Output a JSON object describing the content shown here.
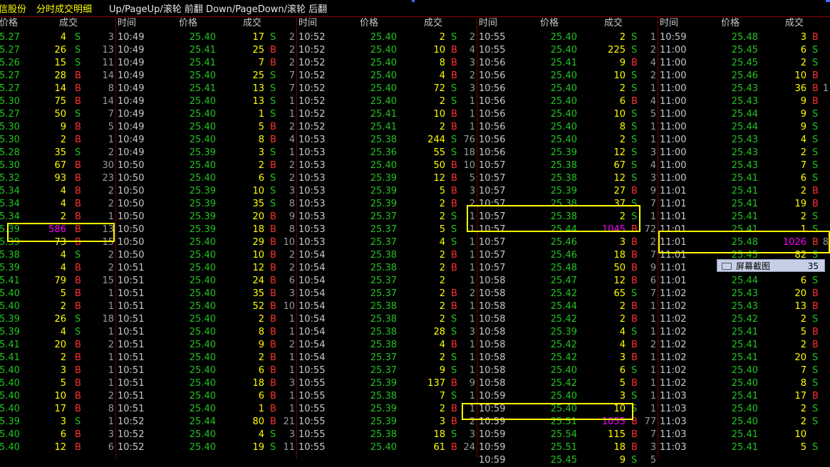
{
  "header": {
    "stock_name": "信股份",
    "view_title": "分时成交明细",
    "nav_hint": "Up/PageUp/滚轮 前翻 Down/PageDown/滚轮 后翻"
  },
  "column_headers": {
    "time": "时间",
    "price": "价格",
    "volume": "成交"
  },
  "columns": [
    {
      "rows": [
        [
          "",
          "5.27",
          "4",
          "S",
          "3"
        ],
        [
          "",
          "5.27",
          "26",
          "S",
          "13"
        ],
        [
          "",
          "5.26",
          "15",
          "S",
          "11"
        ],
        [
          "",
          "5.27",
          "28",
          "B",
          "14"
        ],
        [
          "",
          "5.27",
          "14",
          "B",
          "8"
        ],
        [
          "",
          "5.30",
          "75",
          "B",
          "14"
        ],
        [
          "",
          "5.27",
          "50",
          "S",
          "7"
        ],
        [
          "",
          "5.30",
          "9",
          "B",
          "5"
        ],
        [
          "",
          "5.30",
          "2",
          "B",
          "1"
        ],
        [
          "",
          "5.28",
          "35",
          "S",
          "2"
        ],
        [
          "",
          "5.30",
          "67",
          "B",
          "30"
        ],
        [
          "",
          "5.32",
          "93",
          "B",
          "23"
        ],
        [
          "",
          "5.34",
          "4",
          "B",
          "2"
        ],
        [
          "",
          "5.34",
          "4",
          "B",
          "2"
        ],
        [
          "",
          "5.34",
          "2",
          "B",
          "1"
        ],
        [
          "",
          "5.39",
          "586",
          "B",
          "13"
        ],
        [
          "",
          "5.39",
          "73",
          "B",
          "15"
        ],
        [
          "",
          "5.38",
          "4",
          "S",
          "2"
        ],
        [
          "",
          "5.39",
          "4",
          "B",
          "2"
        ],
        [
          "",
          "5.41",
          "79",
          "B",
          "15"
        ],
        [
          "",
          "5.40",
          "5",
          "B",
          "1"
        ],
        [
          "",
          "5.40",
          "2",
          "B",
          "1"
        ],
        [
          "",
          "5.39",
          "26",
          "S",
          "18"
        ],
        [
          "",
          "5.39",
          "4",
          "S",
          "1"
        ],
        [
          "",
          "5.41",
          "20",
          "B",
          "2"
        ],
        [
          "",
          "5.41",
          "2",
          "B",
          "1"
        ],
        [
          "",
          "5.40",
          "3",
          "B",
          "1"
        ],
        [
          "",
          "5.40",
          "5",
          "B",
          "1"
        ],
        [
          "",
          "5.40",
          "10",
          "B",
          "2"
        ],
        [
          "",
          "5.40",
          "17",
          "B",
          "8"
        ],
        [
          "",
          "5.39",
          "3",
          "S",
          "1"
        ],
        [
          "",
          "5.40",
          "6",
          "B",
          "3"
        ],
        [
          "",
          "5.40",
          "12",
          "B",
          "6"
        ]
      ]
    },
    {
      "rows": [
        [
          "10:49",
          "25.40",
          "17",
          "S",
          "2"
        ],
        [
          "10:49",
          "25.41",
          "25",
          "B",
          "2"
        ],
        [
          "10:49",
          "25.41",
          "7",
          "B",
          "2"
        ],
        [
          "10:49",
          "25.40",
          "25",
          "S",
          "7"
        ],
        [
          "10:49",
          "25.41",
          "13",
          "S",
          "7"
        ],
        [
          "10:49",
          "25.40",
          "13",
          "S",
          "1"
        ],
        [
          "10:49",
          "25.40",
          "1",
          "S",
          "1"
        ],
        [
          "10:49",
          "25.40",
          "5",
          "B",
          "2"
        ],
        [
          "10:49",
          "25.40",
          "8",
          "B",
          "4"
        ],
        [
          "10:49",
          "25.39",
          "3",
          "S",
          "1"
        ],
        [
          "10:50",
          "25.40",
          "2",
          "B",
          "2"
        ],
        [
          "10:50",
          "25.40",
          "6",
          "S",
          "2"
        ],
        [
          "10:50",
          "25.39",
          "10",
          "S",
          "3"
        ],
        [
          "10:50",
          "25.39",
          "35",
          "S",
          "8"
        ],
        [
          "10:50",
          "25.39",
          "20",
          "B",
          "9"
        ],
        [
          "10:50",
          "25.39",
          "18",
          "B",
          "8"
        ],
        [
          "10:50",
          "25.40",
          "29",
          "B",
          "10"
        ],
        [
          "10:50",
          "25.40",
          "10",
          "B",
          "2"
        ],
        [
          "10:51",
          "25.40",
          "12",
          "B",
          "2"
        ],
        [
          "10:51",
          "25.40",
          "24",
          "B",
          "6"
        ],
        [
          "10:51",
          "25.40",
          "35",
          "B",
          "3"
        ],
        [
          "10:51",
          "25.40",
          "52",
          "B",
          "10"
        ],
        [
          "10:51",
          "25.40",
          "2",
          "B",
          "1"
        ],
        [
          "10:51",
          "25.40",
          "8",
          "B",
          "1"
        ],
        [
          "10:51",
          "25.40",
          "9",
          "B",
          "2"
        ],
        [
          "10:51",
          "25.40",
          "2",
          "B",
          "1"
        ],
        [
          "10:51",
          "25.40",
          "6",
          "B",
          "1"
        ],
        [
          "10:51",
          "25.40",
          "18",
          "B",
          "3"
        ],
        [
          "10:51",
          "25.40",
          "6",
          "B",
          "1"
        ],
        [
          "10:51",
          "25.40",
          "1",
          "B",
          "1"
        ],
        [
          "10:52",
          "25.44",
          "80",
          "B",
          "21"
        ],
        [
          "10:52",
          "25.40",
          "4",
          "S",
          "3"
        ],
        [
          "10:52",
          "25.40",
          "19",
          "S",
          "11"
        ]
      ]
    },
    {
      "rows": [
        [
          "10:52",
          "25.40",
          "2",
          "S",
          "2"
        ],
        [
          "10:52",
          "25.40",
          "10",
          "B",
          "4"
        ],
        [
          "10:52",
          "25.40",
          "8",
          "B",
          "3"
        ],
        [
          "10:52",
          "25.40",
          "4",
          "B",
          "2"
        ],
        [
          "10:52",
          "25.40",
          "72",
          "S",
          "3"
        ],
        [
          "10:52",
          "25.40",
          "2",
          "S",
          "1"
        ],
        [
          "10:52",
          "25.41",
          "10",
          "B",
          "1"
        ],
        [
          "10:52",
          "25.41",
          "2",
          "B",
          "1"
        ],
        [
          "10:53",
          "25.38",
          "244",
          "S",
          "76"
        ],
        [
          "10:53",
          "25.36",
          "55",
          "S",
          "18"
        ],
        [
          "10:53",
          "25.40",
          "50",
          "B",
          "10"
        ],
        [
          "10:53",
          "25.39",
          "12",
          "B",
          "5"
        ],
        [
          "10:53",
          "25.39",
          "5",
          "B",
          "3"
        ],
        [
          "10:53",
          "25.39",
          "2",
          "B",
          "2"
        ],
        [
          "10:53",
          "25.37",
          "2",
          "S",
          "1"
        ],
        [
          "10:53",
          "25.37",
          "5",
          "S",
          "1"
        ],
        [
          "10:53",
          "25.37",
          "4",
          "S",
          "1"
        ],
        [
          "10:54",
          "25.38",
          "2",
          "B",
          "1"
        ],
        [
          "10:54",
          "25.38",
          "2",
          "B",
          "1"
        ],
        [
          "10:54",
          "25.37",
          "2",
          "",
          "1"
        ],
        [
          "10:54",
          "25.37",
          "2",
          "B",
          "2"
        ],
        [
          "10:54",
          "25.38",
          "2",
          "B",
          "1"
        ],
        [
          "10:54",
          "25.38",
          "2",
          "S",
          "1"
        ],
        [
          "10:54",
          "25.38",
          "28",
          "S",
          "3"
        ],
        [
          "10:54",
          "25.38",
          "4",
          "B",
          "1"
        ],
        [
          "10:54",
          "25.37",
          "2",
          "S",
          "1"
        ],
        [
          "10:55",
          "25.37",
          "9",
          "S",
          "1"
        ],
        [
          "10:55",
          "25.39",
          "137",
          "B",
          "9"
        ],
        [
          "10:55",
          "25.38",
          "7",
          "S",
          "1"
        ],
        [
          "10:55",
          "25.39",
          "2",
          "B",
          "1"
        ],
        [
          "10:55",
          "25.39",
          "3",
          "B",
          "2"
        ],
        [
          "10:55",
          "25.38",
          "18",
          "S",
          "3"
        ],
        [
          "10:55",
          "25.40",
          "61",
          "B",
          "24"
        ]
      ]
    },
    {
      "rows": [
        [
          "10:55",
          "25.40",
          "2",
          "S",
          "1"
        ],
        [
          "10:55",
          "25.40",
          "225",
          "S",
          "2"
        ],
        [
          "10:56",
          "25.41",
          "9",
          "B",
          "4"
        ],
        [
          "10:56",
          "25.40",
          "10",
          "S",
          "2"
        ],
        [
          "10:56",
          "25.40",
          "2",
          "S",
          "1"
        ],
        [
          "10:56",
          "25.40",
          "6",
          "B",
          "4"
        ],
        [
          "10:56",
          "25.40",
          "10",
          "S",
          "5"
        ],
        [
          "10:56",
          "25.40",
          "8",
          "S",
          "1"
        ],
        [
          "10:56",
          "25.40",
          "2",
          "S",
          "1"
        ],
        [
          "10:56",
          "25.39",
          "12",
          "S",
          "3"
        ],
        [
          "10:57",
          "25.38",
          "67",
          "S",
          "4"
        ],
        [
          "10:57",
          "25.38",
          "12",
          "S",
          "3"
        ],
        [
          "10:57",
          "25.39",
          "27",
          "B",
          "9"
        ],
        [
          "10:57",
          "25.38",
          "37",
          "S",
          "7"
        ],
        [
          "10:57",
          "25.38",
          "2",
          "S",
          "1"
        ],
        [
          "10:57",
          "25.44",
          "1045",
          "B",
          "72"
        ],
        [
          "10:57",
          "25.46",
          "3",
          "B",
          "2"
        ],
        [
          "10:57",
          "25.46",
          "18",
          "B",
          "7"
        ],
        [
          "10:57",
          "25.48",
          "50",
          "B",
          "9"
        ],
        [
          "10:58",
          "25.47",
          "12",
          "B",
          "6"
        ],
        [
          "10:58",
          "25.42",
          "65",
          "S",
          "7"
        ],
        [
          "10:58",
          "25.44",
          "2",
          "B",
          "1"
        ],
        [
          "10:58",
          "25.42",
          "2",
          "B",
          "1"
        ],
        [
          "10:58",
          "25.39",
          "4",
          "S",
          "1"
        ],
        [
          "10:58",
          "25.42",
          "4",
          "B",
          "2"
        ],
        [
          "10:58",
          "25.42",
          "3",
          "B",
          "1"
        ],
        [
          "10:58",
          "25.40",
          "6",
          "S",
          "1"
        ],
        [
          "10:58",
          "25.42",
          "5",
          "B",
          "1"
        ],
        [
          "10:59",
          "25.40",
          "3",
          "S",
          "1"
        ],
        [
          "10:59",
          "25.40",
          "10",
          "S",
          "1"
        ],
        [
          "10:59",
          "25.51",
          "1055",
          "B",
          "77"
        ],
        [
          "10:59",
          "25.54",
          "115",
          "B",
          "7"
        ],
        [
          "10:59",
          "25.51",
          "18",
          "B",
          "3"
        ],
        [
          "10:59",
          "25.45",
          "9",
          "S",
          "5"
        ]
      ]
    },
    {
      "rows": [
        [
          "10:59",
          "25.48",
          "3",
          "B",
          ""
        ],
        [
          "11:00",
          "25.45",
          "6",
          "S",
          ""
        ],
        [
          "11:00",
          "25.45",
          "2",
          "S",
          ""
        ],
        [
          "11:00",
          "25.46",
          "10",
          "B",
          ""
        ],
        [
          "11:00",
          "25.43",
          "36",
          "B",
          "1"
        ],
        [
          "11:00",
          "25.43",
          "9",
          "B",
          ""
        ],
        [
          "11:00",
          "25.44",
          "9",
          "S",
          ""
        ],
        [
          "11:00",
          "25.44",
          "9",
          "S",
          ""
        ],
        [
          "11:00",
          "25.43",
          "4",
          "S",
          ""
        ],
        [
          "11:00",
          "25.43",
          "2",
          "S",
          ""
        ],
        [
          "11:00",
          "25.43",
          "7",
          "S",
          ""
        ],
        [
          "11:00",
          "25.41",
          "6",
          "S",
          ""
        ],
        [
          "11:01",
          "25.41",
          "2",
          "B",
          ""
        ],
        [
          "11:01",
          "25.41",
          "19",
          "B",
          ""
        ],
        [
          "11:01",
          "25.41",
          "2",
          "S",
          ""
        ],
        [
          "11:01",
          "25.41",
          "1",
          "S",
          ""
        ],
        [
          "11:01",
          "25.48",
          "1026",
          "B",
          "8"
        ],
        [
          "11:01",
          "25.45",
          "82",
          "S",
          ""
        ],
        [
          "11:01",
          "25.40",
          "8",
          "S",
          ""
        ],
        [
          "11:01",
          "25.44",
          "6",
          "S",
          ""
        ],
        [
          "11:02",
          "25.43",
          "20",
          "B",
          ""
        ],
        [
          "11:02",
          "25.43",
          "13",
          "B",
          ""
        ],
        [
          "11:02",
          "25.42",
          "2",
          "S",
          ""
        ],
        [
          "11:02",
          "25.41",
          "5",
          "B",
          ""
        ],
        [
          "11:02",
          "25.41",
          "2",
          "B",
          ""
        ],
        [
          "11:02",
          "25.41",
          "20",
          "S",
          ""
        ],
        [
          "11:02",
          "25.40",
          "7",
          "S",
          ""
        ],
        [
          "11:02",
          "25.40",
          "8",
          "S",
          ""
        ],
        [
          "11:03",
          "25.41",
          "17",
          "B",
          ""
        ],
        [
          "11:03",
          "25.40",
          "2",
          "S",
          ""
        ],
        [
          "11:03",
          "25.40",
          "2",
          "S",
          ""
        ],
        [
          "11:03",
          "25.41",
          "10",
          "",
          ""
        ],
        [
          "11:03",
          "25.41",
          "5",
          "S",
          ""
        ]
      ]
    }
  ],
  "overlay": {
    "capture_label": "屏幕截图",
    "capture_count": "35"
  },
  "colors": {
    "buy": "#ff3030",
    "sell": "#21c321",
    "volume": "#ffff00",
    "big_volume": "#ff00ff",
    "highlight": "#ffff00"
  }
}
